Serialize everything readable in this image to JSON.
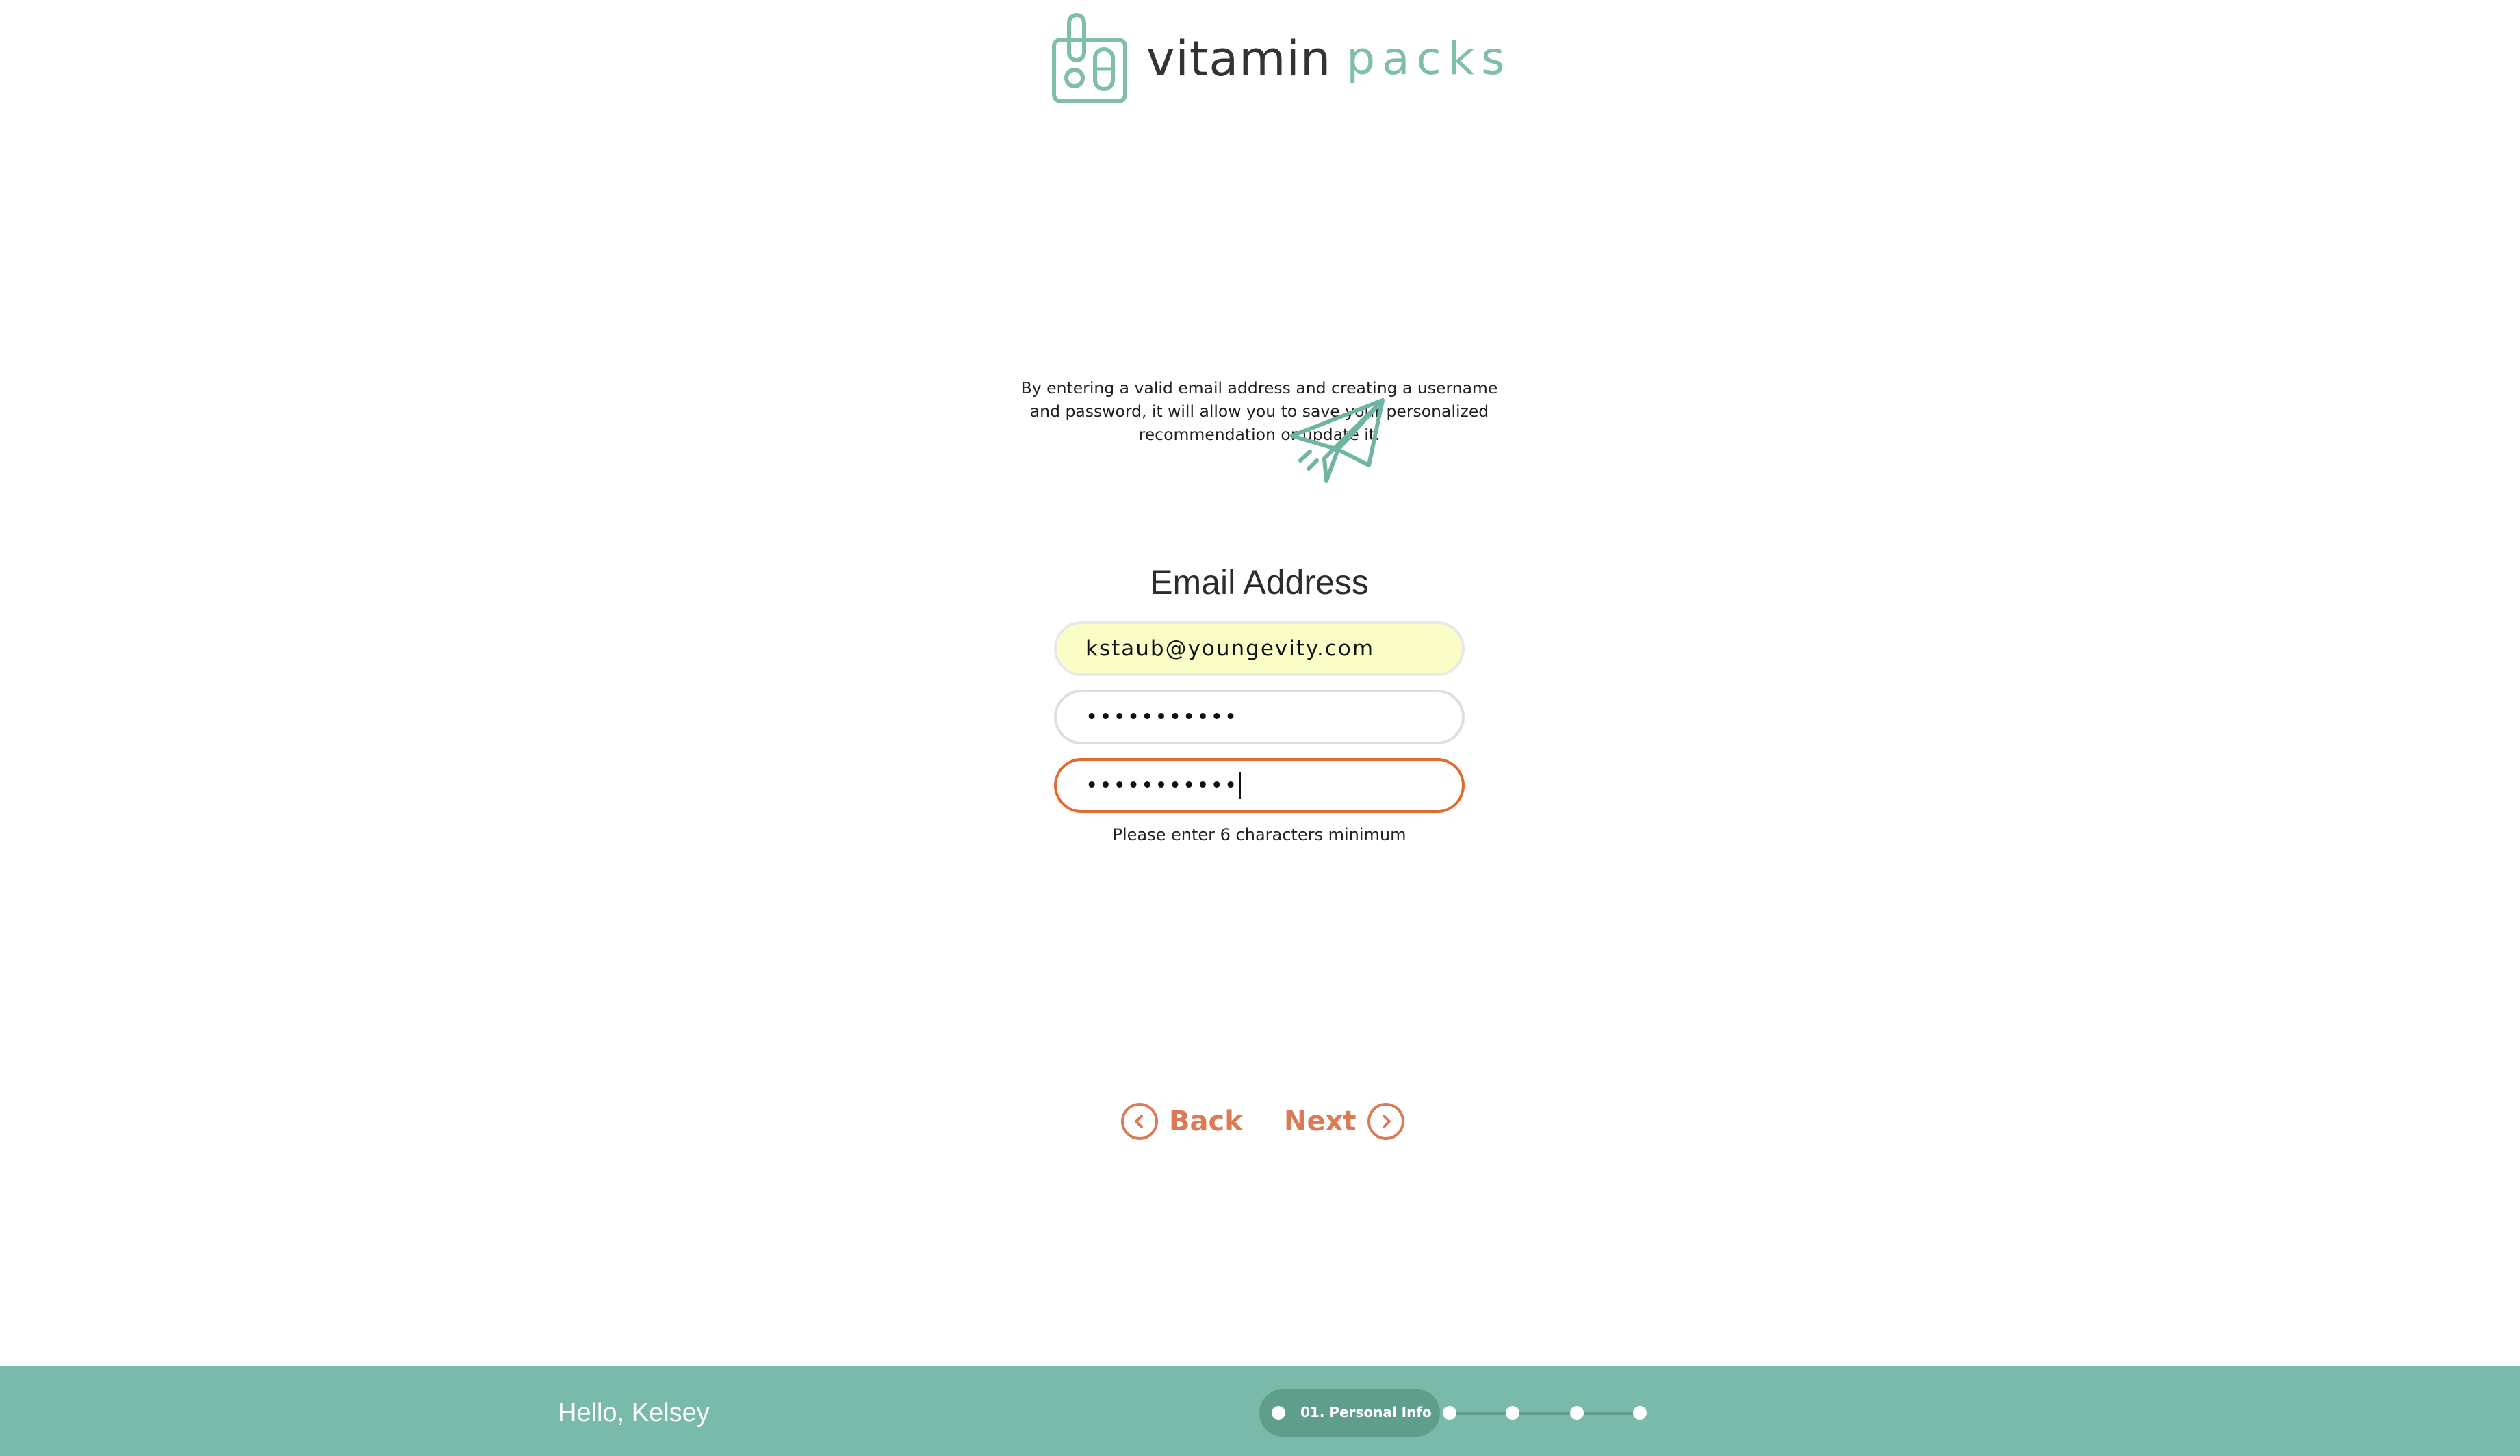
{
  "brand": {
    "name_strong": "vitamin",
    "name_light": "packs",
    "accent": "#7fbdad",
    "action_color": "#dc7a55",
    "error_color": "#e36a2e"
  },
  "intro": {
    "text": "By entering a valid email address and creating a username and password, it will allow you to save your personalized recommendation or update it."
  },
  "form": {
    "title": "Email Address",
    "email_value": "kstaub@youngevity.com",
    "password_value": "•••••••••••",
    "confirm_value": "•••••••••••",
    "hint": "Please enter 6 characters minimum"
  },
  "nav": {
    "back_label": "Back",
    "next_label": "Next"
  },
  "footer": {
    "greeting": "Hello, Kelsey",
    "current_step": "01. Personal Info",
    "total_steps": 5,
    "current_step_index": 1,
    "bg_color": "#7abaaa"
  }
}
